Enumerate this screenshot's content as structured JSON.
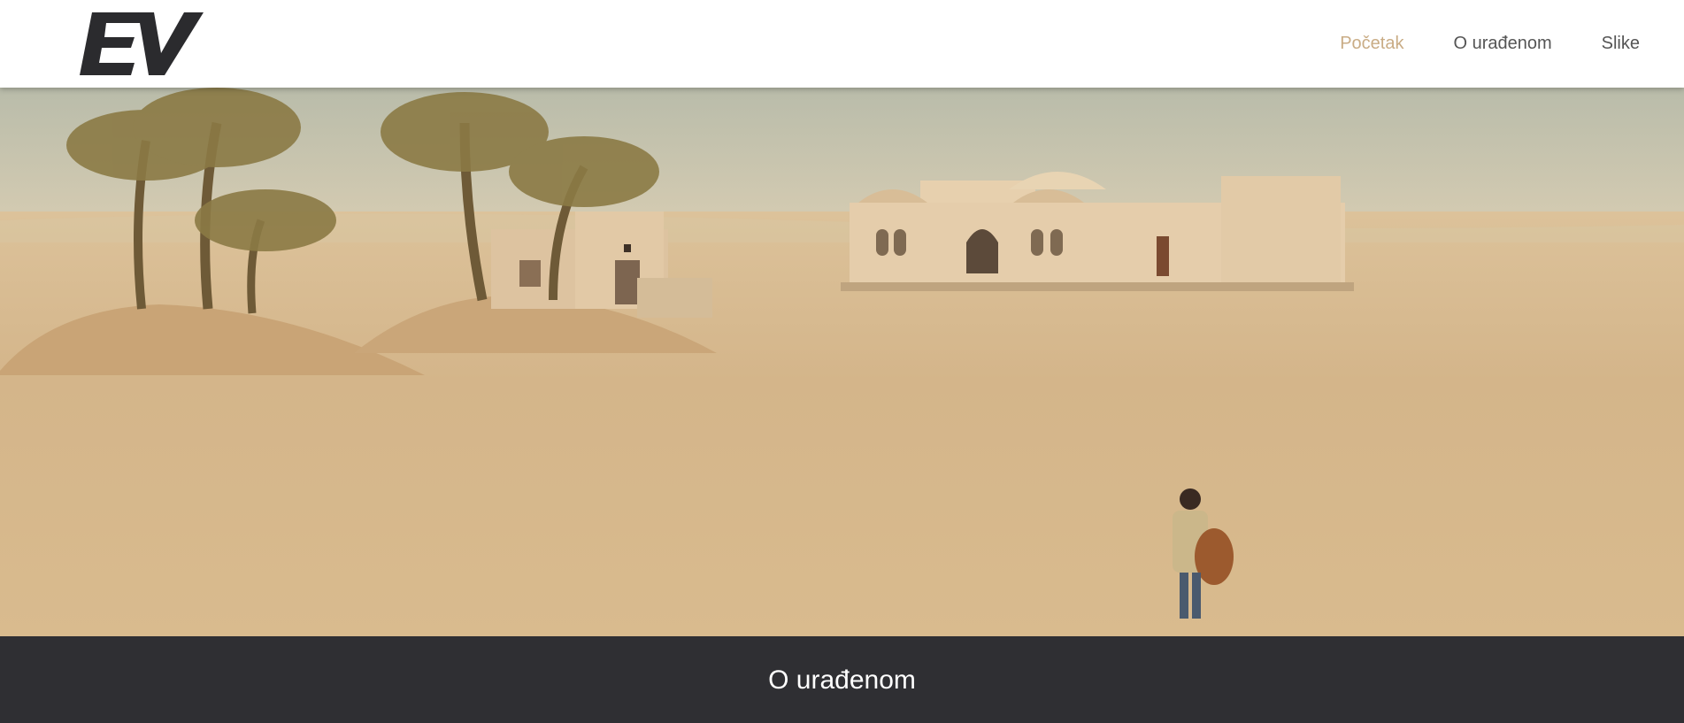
{
  "header": {
    "logo_text": "EV",
    "nav": [
      {
        "label": "Početak",
        "active": true
      },
      {
        "label": "O urađenom",
        "active": false
      },
      {
        "label": "Slike",
        "active": false
      }
    ]
  },
  "hero": {
    "image": "desert-oasis-photo"
  },
  "section": {
    "title": "O urađenom"
  },
  "colors": {
    "header_bg": "#ffffff",
    "nav_active": "#c9ac85",
    "nav_text": "#555555",
    "band_bg": "#2f2f33",
    "logo": "#2b2b2e"
  }
}
